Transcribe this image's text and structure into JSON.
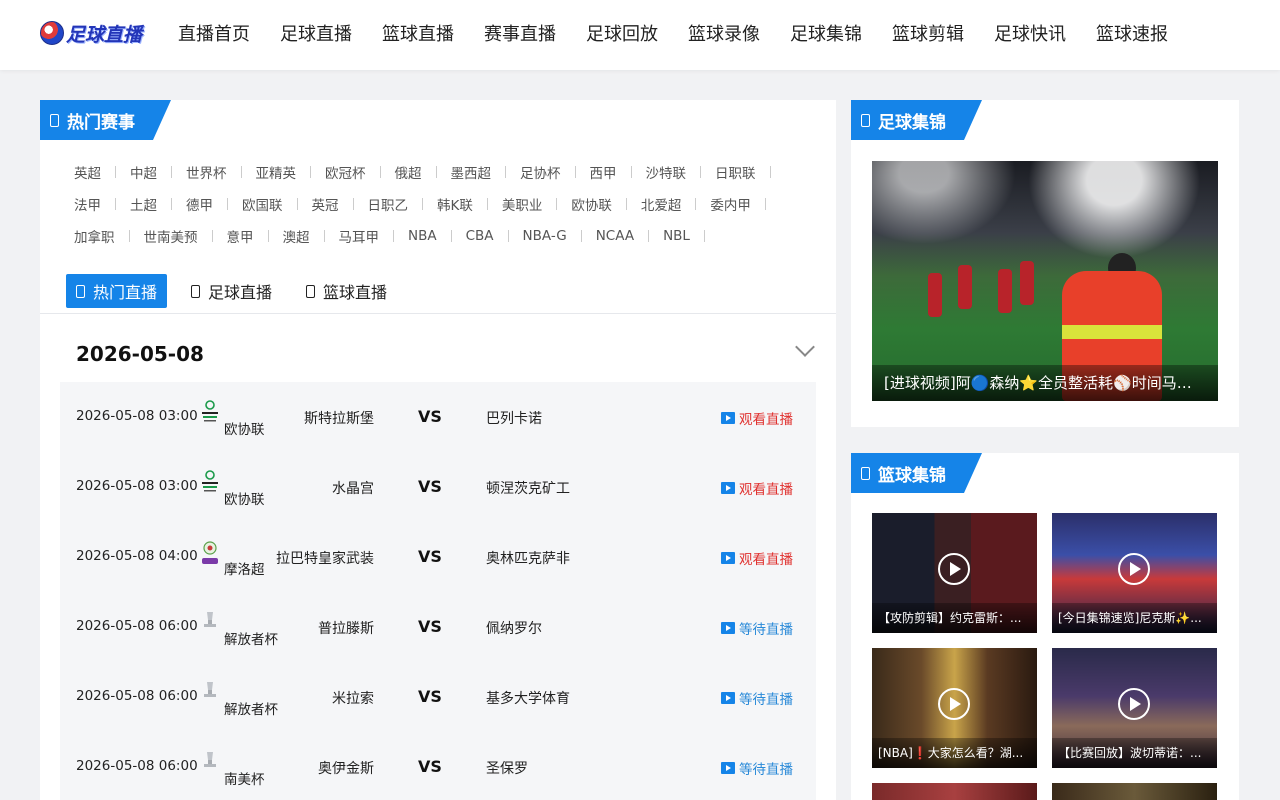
{
  "header": {
    "logo_text": "足球直播",
    "nav": [
      "直播首页",
      "足球直播",
      "篮球直播",
      "赛事直播",
      "足球回放",
      "篮球录像",
      "足球集锦",
      "篮球剪辑",
      "足球快讯",
      "篮球速报"
    ]
  },
  "hot_events": {
    "title": "热门赛事",
    "rows": [
      [
        "英超",
        "中超",
        "世界杯",
        "亚精英",
        "欧冠杯",
        "俄超",
        "墨西超",
        "足协杯",
        "西甲",
        "沙特联",
        "日职联"
      ],
      [
        "法甲",
        "土超",
        "德甲",
        "欧国联",
        "英冠",
        "日职乙",
        "韩K联",
        "美职业",
        "欧协联",
        "北爱超",
        "委内甲"
      ],
      [
        "加拿职",
        "世南美预",
        "意甲",
        "澳超",
        "马耳甲",
        "NBA",
        "CBA",
        "NBA-G",
        "NCAA",
        "NBL"
      ]
    ]
  },
  "tabs": [
    "热门直播",
    "足球直播",
    "篮球直播"
  ],
  "schedule": {
    "date": "2026-05-08",
    "matches": [
      {
        "time": "2026-05-08 03:00",
        "league": "欧协联",
        "home": "斯特拉斯堡",
        "vs": "VS",
        "away": "巴列卡诺",
        "action": "观看直播",
        "status": "live"
      },
      {
        "time": "2026-05-08 03:00",
        "league": "欧协联",
        "home": "水晶宫",
        "vs": "VS",
        "away": "顿涅茨克矿工",
        "action": "观看直播",
        "status": "live"
      },
      {
        "time": "2026-05-08 04:00",
        "league": "摩洛超",
        "home": "拉巴特皇家武装",
        "vs": "VS",
        "away": "奥林匹克萨非",
        "action": "观看直播",
        "status": "live"
      },
      {
        "time": "2026-05-08 06:00",
        "league": "解放者杯",
        "home": "普拉滕斯",
        "vs": "VS",
        "away": "佩纳罗尔",
        "action": "等待直播",
        "status": "wait"
      },
      {
        "time": "2026-05-08 06:00",
        "league": "解放者杯",
        "home": "米拉索",
        "vs": "VS",
        "away": "基多大学体育",
        "action": "等待直播",
        "status": "wait"
      },
      {
        "time": "2026-05-08 06:00",
        "league": "南美杯",
        "home": "奥伊金斯",
        "vs": "VS",
        "away": "圣保罗",
        "action": "等待直播",
        "status": "wait"
      }
    ]
  },
  "football_highlights": {
    "title": "足球集锦",
    "feature_caption": "[进球视频]阿🔵森纳⭐全员整活耗⚾时间马丁..."
  },
  "basketball_highlights": {
    "title": "篮球集锦",
    "items": [
      {
        "caption": "【攻防剪辑】约克雷斯：..."
      },
      {
        "caption": "[今日集锦速览]尼克斯✨..."
      },
      {
        "caption": "[NBA]❗大家怎么看？湖..."
      },
      {
        "caption": "【比赛回放】波切蒂诺：..."
      }
    ]
  },
  "colors": {
    "accent": "#1584e8",
    "live": "#e0312f",
    "wait": "#2a8ad8"
  }
}
